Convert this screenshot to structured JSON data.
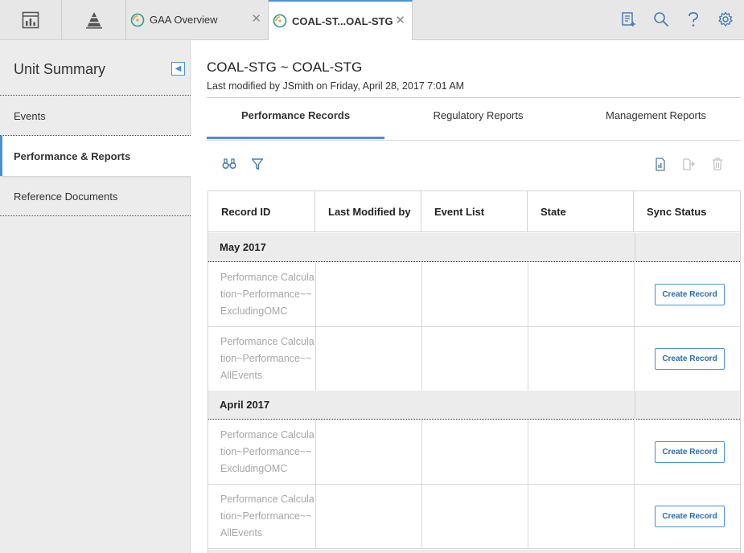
{
  "topbar": {
    "tabs": [
      {
        "label": "GAA Overview",
        "close": "✕"
      },
      {
        "label": "COAL-ST...OAL-STG",
        "close": "✕"
      }
    ]
  },
  "sidebar": {
    "title": "Unit Summary",
    "items": [
      {
        "label": "Events"
      },
      {
        "label": "Performance & Reports"
      },
      {
        "label": "Reference Documents"
      }
    ]
  },
  "main": {
    "title": "COAL-STG ~ COAL-STG",
    "subtitle": "Last modified by JSmith on Friday, April 28, 2017 7:01 AM",
    "tabs": [
      {
        "label": "Performance Records"
      },
      {
        "label": "Regulatory Reports"
      },
      {
        "label": "Management Reports"
      }
    ]
  },
  "table": {
    "columns": [
      "Record ID",
      "Last Modified by",
      "Event List",
      "State",
      "Sync Status"
    ],
    "groups": [
      {
        "label": "May 2017",
        "rows": [
          {
            "record_id": "Performance Calculation~Performance~~ExcludingOMC",
            "button": "Create Record"
          },
          {
            "record_id": "Performance Calculation~Performance~~AllEvents",
            "button": "Create Record"
          }
        ]
      },
      {
        "label": "April 2017",
        "rows": [
          {
            "record_id": "Performance Calculation~Performance~~ExcludingOMC",
            "button": "Create Record"
          },
          {
            "record_id": "Performance Calculation~Performance~~AllEvents",
            "button": "Create Record"
          }
        ]
      }
    ]
  },
  "colors": {
    "accent": "#4a90d9",
    "sidebar_bg": "#ececec",
    "topbar_bg": "#e7e7e7",
    "muted_text": "#a6a6a6"
  },
  "icons": [
    "dashboard-icon",
    "pyramid-icon",
    "tab-globe-icon",
    "new-record-icon",
    "search-icon",
    "help-icon",
    "settings-icon",
    "binoculars-icon",
    "filter-icon",
    "document-icon",
    "copy-icon",
    "trash-icon"
  ]
}
